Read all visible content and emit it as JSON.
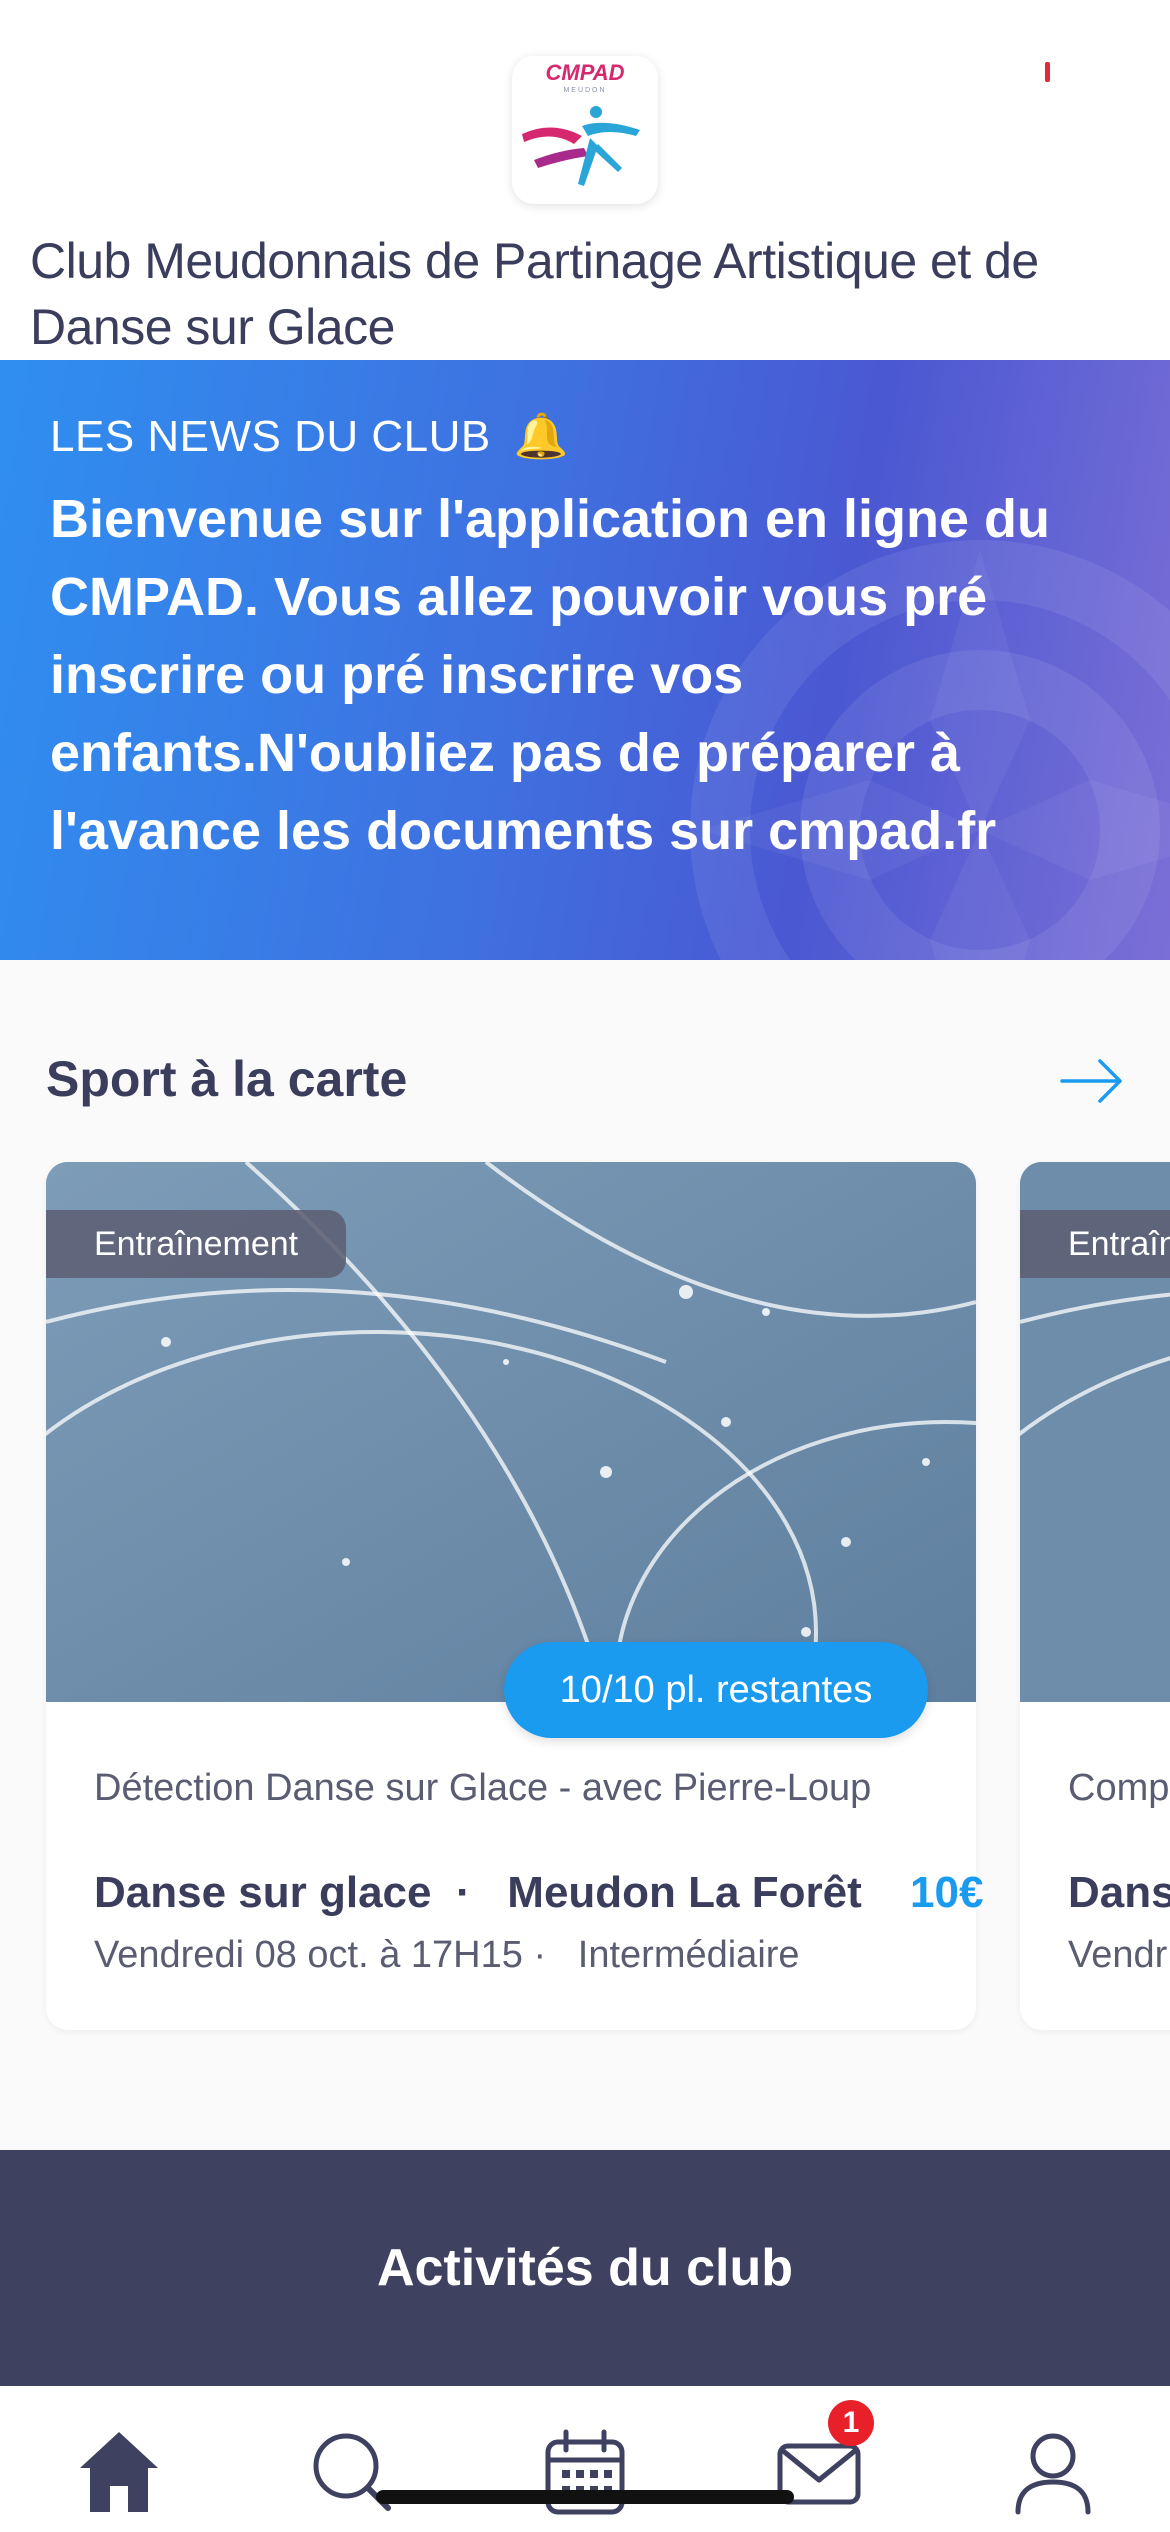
{
  "header": {
    "logo_text": "CMPAD",
    "logo_subtext": "MEUDON",
    "club_name": "Club Meudonnais de Partinage Artistique et de Danse sur Glace"
  },
  "news": {
    "kicker": "LES NEWS DU CLUB",
    "kicker_emoji": "🔔",
    "text": "Bienvenue sur l'application en ligne du CMPAD. Vous allez pouvoir vous pré inscrire ou pré inscrire vos enfants.N'oubliez pas de préparer à l'avance les documents sur cmpad.fr"
  },
  "sport": {
    "title": "Sport à la carte",
    "cards": [
      {
        "tag": "Entraînement",
        "places": "10/10 pl. restantes",
        "subtitle": "Détection Danse sur Glace - avec Pierre-Loup",
        "discipline": "Danse sur glace",
        "location": "Meudon La Forêt",
        "price": "10€",
        "date": "Vendredi 08 oct. à 17H15",
        "level": "Intermédiaire"
      },
      {
        "tag": "Entraîn",
        "subtitle": "Comp Loup",
        "discipline": "Dans",
        "date": "Vendr"
      }
    ]
  },
  "activities": {
    "title": "Activités du club"
  },
  "tabbar": {
    "items": [
      "home",
      "search",
      "calendar",
      "messages",
      "profile"
    ],
    "messages_badge": "1"
  },
  "colors": {
    "primary_dark": "#3e4160",
    "accent_blue": "#1a9bf0",
    "badge_red": "#e8202a"
  }
}
